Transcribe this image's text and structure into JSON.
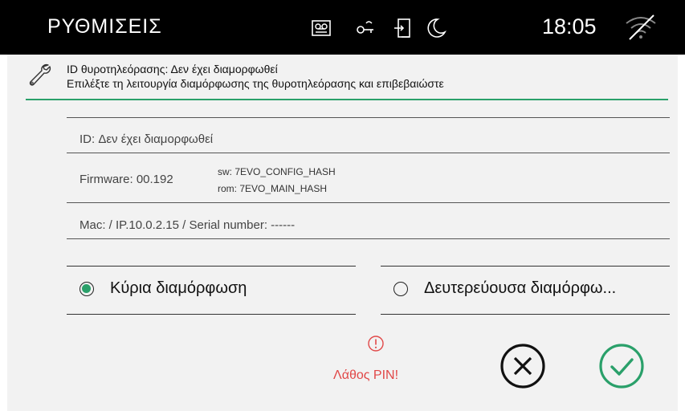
{
  "topbar": {
    "title": "ΡΥΘΜΙΣΕΙΣ",
    "time": "18:05",
    "icons": [
      "voicemail-icon",
      "key-icon",
      "door-icon",
      "moon-icon",
      "wifi-off-icon"
    ]
  },
  "header": {
    "line1": "ID θυροτηλεόρασης: Δεν έχει διαμορφωθεί",
    "line2": "Επιλέξτε τη λειτουργία διαμόρφωσης της θυροτηλεόρασης και επιβεβαιώστε"
  },
  "info": {
    "id": "ID: Δεν έχει διαμορφωθεί",
    "firmware": "Firmware: 00.192",
    "sw": "sw: 7EVO_CONFIG_HASH",
    "rom": "rom: 7EVO_MAIN_HASH",
    "mac": "Mac:  / IP.10.0.2.15 / Serial number: ------"
  },
  "options": {
    "primary": "Κύρια διαμόρφωση",
    "secondary": "Δευτερεύουσα διαμόρφω...",
    "selected": "primary"
  },
  "error": {
    "text": "Λάθος PIN!"
  },
  "colors": {
    "accent": "#2aa06a",
    "error": "#e14848",
    "topbar": "#000000",
    "panel": "#f2f2f2"
  }
}
